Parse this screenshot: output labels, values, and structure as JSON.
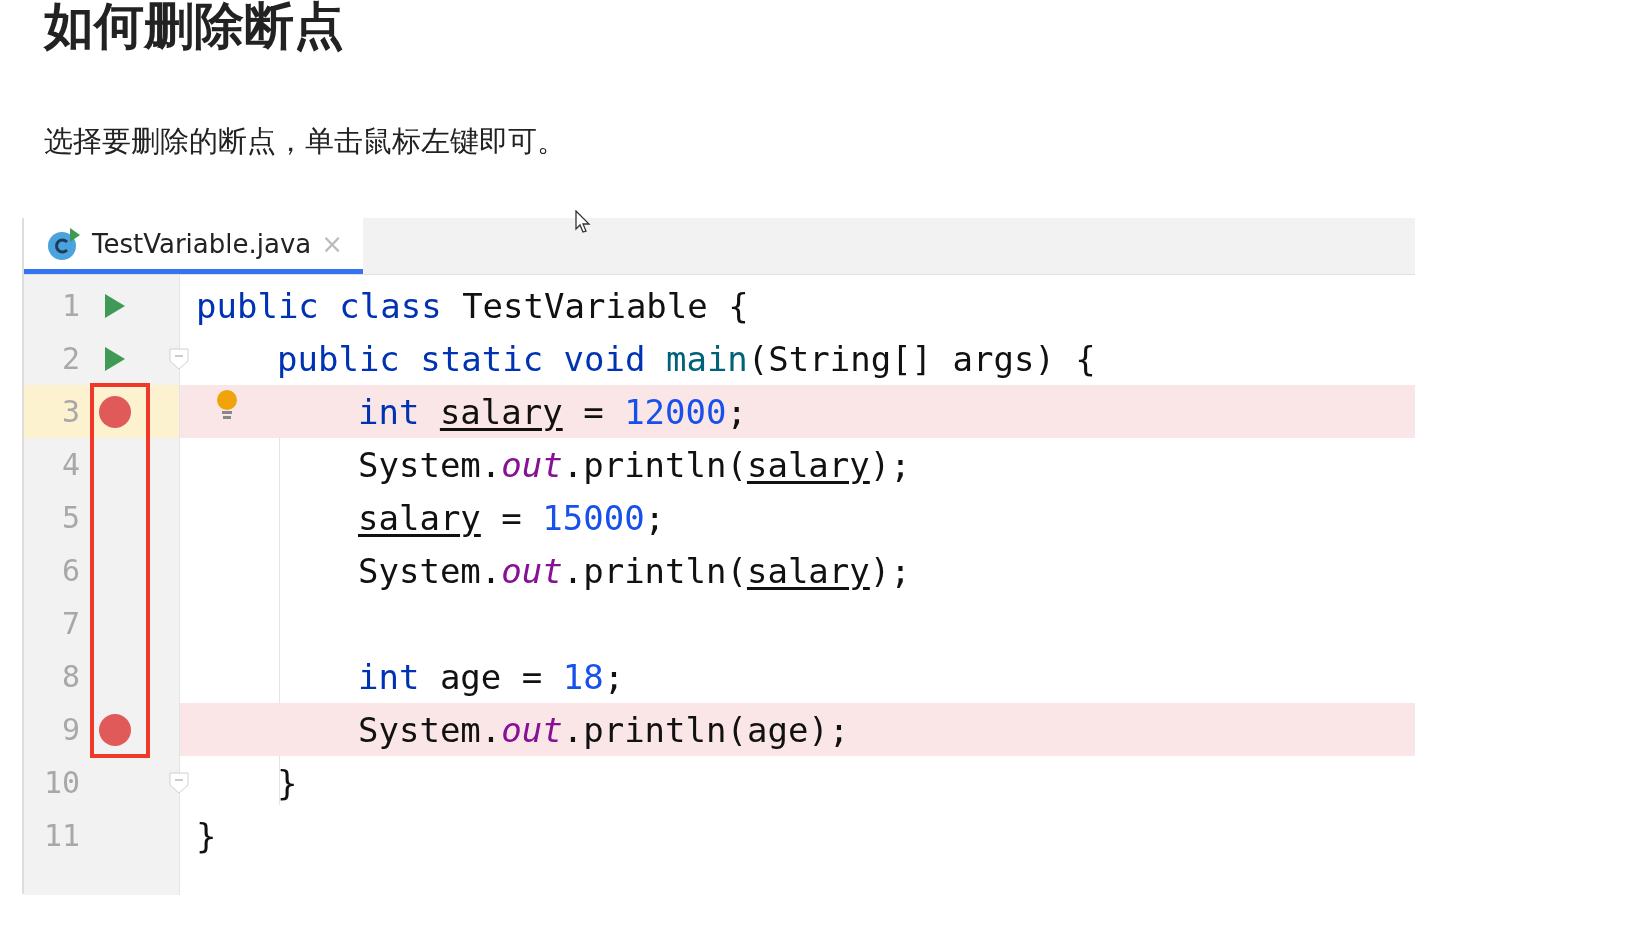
{
  "title": "如何删除断点",
  "instruction": "选择要删除的断点，单击鼠标左键即可。",
  "editor": {
    "tabs": [
      {
        "label": "TestVariable.java",
        "close": "×",
        "selected": true
      }
    ],
    "lines": [
      {
        "number": "1",
        "run": true,
        "breakpoint": false,
        "highlighted": false,
        "current": false,
        "fold": false,
        "bulb": false,
        "tokens": [
          {
            "text": "public",
            "kind": "keyword"
          },
          {
            "text": " class",
            "kind": "keyword"
          },
          {
            "text": " TestVariable {",
            "kind": "plain"
          }
        ],
        "children": [
          {
            "number": "2",
            "run": true,
            "breakpoint": false,
            "highlighted": false,
            "current": false,
            "fold": true,
            "bulb": false,
            "tokens": [
              {
                "text": "public",
                "kind": "keyword"
              },
              {
                "text": " static",
                "kind": "keyword"
              },
              {
                "text": " void",
                "kind": "keyword"
              },
              {
                "text": " main",
                "kind": "method"
              },
              {
                "text": "(String[] args) {",
                "kind": "plain"
              }
            ],
            "children": [
              {
                "number": "3",
                "run": false,
                "breakpoint": true,
                "highlighted": true,
                "current": true,
                "fold": false,
                "bulb": true,
                "tokens": [
                  {
                    "text": "int ",
                    "kind": "keyword"
                  },
                  {
                    "text": "salary",
                    "kind": "variable"
                  },
                  {
                    "text": " = ",
                    "kind": "plain"
                  },
                  {
                    "text": "12000",
                    "kind": "number"
                  },
                  {
                    "text": ";",
                    "kind": "plain"
                  }
                ]
              },
              {
                "number": "4",
                "run": false,
                "breakpoint": false,
                "highlighted": false,
                "current": false,
                "fold": false,
                "bulb": false,
                "tokens": [
                  {
                    "text": "System.",
                    "kind": "plain"
                  },
                  {
                    "text": "out",
                    "kind": "field"
                  },
                  {
                    "text": ".println(",
                    "kind": "plain"
                  },
                  {
                    "text": "salary",
                    "kind": "variable"
                  },
                  {
                    "text": ");",
                    "kind": "plain"
                  }
                ]
              },
              {
                "number": "5",
                "run": false,
                "breakpoint": false,
                "highlighted": false,
                "current": false,
                "fold": false,
                "bulb": false,
                "tokens": [
                  {
                    "text": "salary",
                    "kind": "variable"
                  },
                  {
                    "text": " = ",
                    "kind": "plain"
                  },
                  {
                    "text": "15000",
                    "kind": "number"
                  },
                  {
                    "text": ";",
                    "kind": "plain"
                  }
                ]
              },
              {
                "number": "6",
                "run": false,
                "breakpoint": false,
                "highlighted": false,
                "current": false,
                "fold": false,
                "bulb": false,
                "tokens": [
                  {
                    "text": "System.",
                    "kind": "plain"
                  },
                  {
                    "text": "out",
                    "kind": "field"
                  },
                  {
                    "text": ".println(",
                    "kind": "plain"
                  },
                  {
                    "text": "salary",
                    "kind": "variable"
                  },
                  {
                    "text": ");",
                    "kind": "plain"
                  }
                ]
              },
              {
                "number": "7",
                "run": false,
                "breakpoint": false,
                "highlighted": false,
                "current": false,
                "fold": false,
                "bulb": false
              },
              {
                "number": "8",
                "run": false,
                "breakpoint": false,
                "highlighted": false,
                "current": false,
                "fold": false,
                "bulb": false,
                "tokens": [
                  {
                    "text": "int",
                    "kind": "keyword"
                  },
                  {
                    "text": " age = ",
                    "kind": "plain"
                  },
                  {
                    "text": "18",
                    "kind": "number"
                  },
                  {
                    "text": ";",
                    "kind": "plain"
                  }
                ]
              },
              {
                "number": "9",
                "run": false,
                "breakpoint": true,
                "highlighted": true,
                "current": false,
                "fold": false,
                "bulb": false,
                "tokens": [
                  {
                    "text": "System.",
                    "kind": "plain"
                  },
                  {
                    "text": "out",
                    "kind": "field"
                  },
                  {
                    "text": ".println(age);",
                    "kind": "plain"
                  }
                ]
              }
            ]
          },
          {
            "number": "10",
            "run": false,
            "breakpoint": false,
            "highlighted": false,
            "current": false,
            "fold": true,
            "bulb": false,
            "tokens": [
              {
                "text": "}",
                "kind": "plain"
              }
            ]
          }
        ]
      },
      {
        "number": "11",
        "run": false,
        "breakpoint": false,
        "highlighted": false,
        "current": false,
        "fold": false,
        "bulb": false,
        "tokens": [
          {
            "text": "}",
            "kind": "plain"
          }
        ]
      }
    ]
  }
}
